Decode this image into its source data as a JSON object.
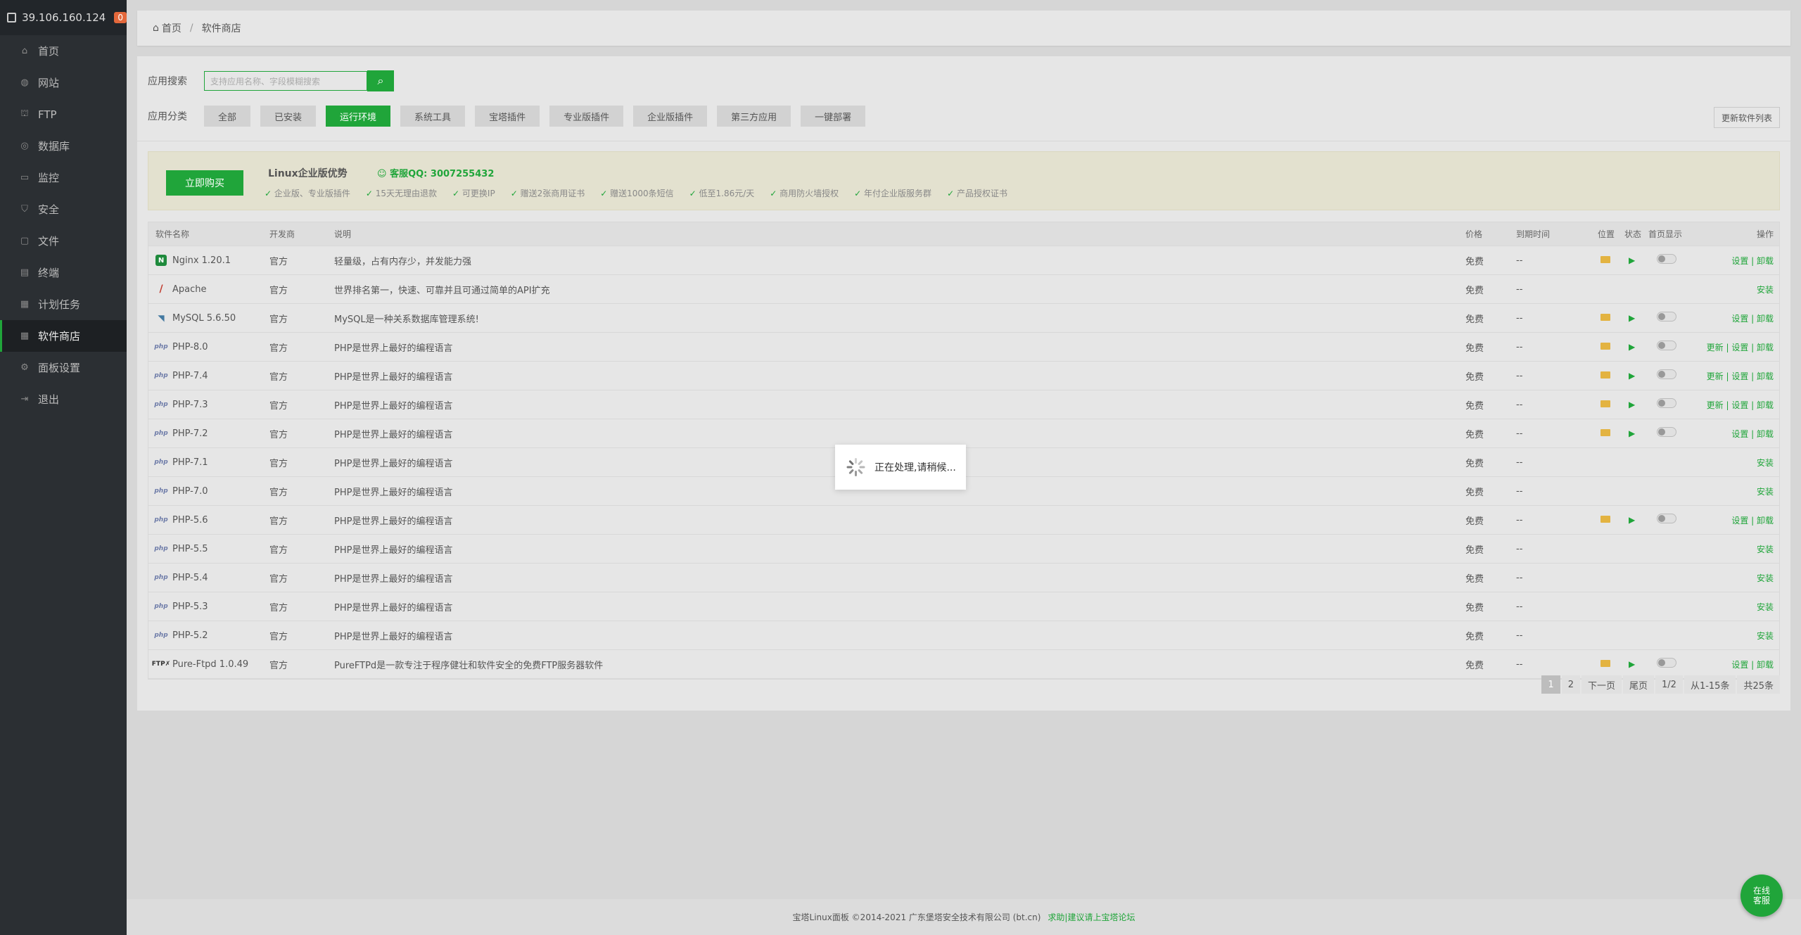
{
  "server": {
    "ip": "39.106.160.124",
    "badge": "0"
  },
  "nav": [
    {
      "label": "首页",
      "icon": "home-icon"
    },
    {
      "label": "网站",
      "icon": "globe-icon"
    },
    {
      "label": "FTP",
      "icon": "ftp-icon"
    },
    {
      "label": "数据库",
      "icon": "database-icon"
    },
    {
      "label": "监控",
      "icon": "monitor-icon"
    },
    {
      "label": "安全",
      "icon": "shield-icon"
    },
    {
      "label": "文件",
      "icon": "folder-icon"
    },
    {
      "label": "终端",
      "icon": "terminal-icon"
    },
    {
      "label": "计划任务",
      "icon": "calendar-icon"
    },
    {
      "label": "软件商店",
      "icon": "grid-icon",
      "active": true
    },
    {
      "label": "面板设置",
      "icon": "gear-icon"
    },
    {
      "label": "退出",
      "icon": "logout-icon"
    }
  ],
  "breadcrumb": {
    "home": "首页",
    "sep": "/",
    "current": "软件商店"
  },
  "search": {
    "label": "应用搜索",
    "placeholder": "支持应用名称、字段模糊搜索"
  },
  "categories": {
    "label": "应用分类",
    "items": [
      "全部",
      "已安装",
      "运行环境",
      "系统工具",
      "宝塔插件",
      "专业版插件",
      "企业版插件",
      "第三方应用",
      "一键部署"
    ],
    "active_index": 2
  },
  "refresh_label": "更新软件列表",
  "promo": {
    "buy": "立即购买",
    "title": "Linux企业版优势",
    "qq": "客服QQ: 3007255432",
    "features": [
      "企业版、专业版插件",
      "15天无理由退款",
      "可更换IP",
      "赠送2张商用证书",
      "赠送1000条短信",
      "低至1.86元/天",
      "商用防火墙授权",
      "年付企业版服务群",
      "产品授权证书"
    ]
  },
  "table": {
    "headers": {
      "name": "软件名称",
      "dev": "开发商",
      "desc": "说明",
      "price": "价格",
      "exp": "到期时间",
      "pos": "位置",
      "state": "状态",
      "home": "首页显示",
      "ops": "操作"
    },
    "rows": [
      {
        "logo": "N",
        "type": "nginx",
        "name": "Nginx 1.20.1",
        "dev": "官方",
        "desc": "轻量级，占有内存少，并发能力强",
        "price": "免费",
        "exp": "--",
        "installed": true,
        "ops": "设置 | 卸载"
      },
      {
        "logo": "/",
        "type": "apache",
        "name": "Apache",
        "dev": "官方",
        "desc": "世界排名第一，快速、可靠并且可通过简单的API扩充",
        "price": "免费",
        "exp": "--",
        "installed": false,
        "ops": "安装"
      },
      {
        "logo": "◥",
        "type": "mysql",
        "name": "MySQL 5.6.50",
        "dev": "官方",
        "desc": "MySQL是一种关系数据库管理系统!",
        "price": "免费",
        "exp": "--",
        "installed": true,
        "ops": "设置 | 卸载"
      },
      {
        "logo": "php",
        "type": "php",
        "name": "PHP-8.0",
        "dev": "官方",
        "desc": "PHP是世界上最好的编程语言",
        "price": "免费",
        "exp": "--",
        "installed": true,
        "ops": "更新 | 设置 | 卸载"
      },
      {
        "logo": "php",
        "type": "php",
        "name": "PHP-7.4",
        "dev": "官方",
        "desc": "PHP是世界上最好的编程语言",
        "price": "免费",
        "exp": "--",
        "installed": true,
        "ops": "更新 | 设置 | 卸载"
      },
      {
        "logo": "php",
        "type": "php",
        "name": "PHP-7.3",
        "dev": "官方",
        "desc": "PHP是世界上最好的编程语言",
        "price": "免费",
        "exp": "--",
        "installed": true,
        "ops": "更新 | 设置 | 卸载"
      },
      {
        "logo": "php",
        "type": "php",
        "name": "PHP-7.2",
        "dev": "官方",
        "desc": "PHP是世界上最好的编程语言",
        "price": "免费",
        "exp": "--",
        "installed": true,
        "ops": "设置 | 卸载"
      },
      {
        "logo": "php",
        "type": "php",
        "name": "PHP-7.1",
        "dev": "官方",
        "desc": "PHP是世界上最好的编程语言",
        "price": "免费",
        "exp": "--",
        "installed": false,
        "ops": "安装"
      },
      {
        "logo": "php",
        "type": "php",
        "name": "PHP-7.0",
        "dev": "官方",
        "desc": "PHP是世界上最好的编程语言",
        "price": "免费",
        "exp": "--",
        "installed": false,
        "ops": "安装"
      },
      {
        "logo": "php",
        "type": "php",
        "name": "PHP-5.6",
        "dev": "官方",
        "desc": "PHP是世界上最好的编程语言",
        "price": "免费",
        "exp": "--",
        "installed": true,
        "ops": "设置 | 卸载"
      },
      {
        "logo": "php",
        "type": "php",
        "name": "PHP-5.5",
        "dev": "官方",
        "desc": "PHP是世界上最好的编程语言",
        "price": "免费",
        "exp": "--",
        "installed": false,
        "ops": "安装"
      },
      {
        "logo": "php",
        "type": "php",
        "name": "PHP-5.4",
        "dev": "官方",
        "desc": "PHP是世界上最好的编程语言",
        "price": "免费",
        "exp": "--",
        "installed": false,
        "ops": "安装"
      },
      {
        "logo": "php",
        "type": "php",
        "name": "PHP-5.3",
        "dev": "官方",
        "desc": "PHP是世界上最好的编程语言",
        "price": "免费",
        "exp": "--",
        "installed": false,
        "ops": "安装"
      },
      {
        "logo": "php",
        "type": "php",
        "name": "PHP-5.2",
        "dev": "官方",
        "desc": "PHP是世界上最好的编程语言",
        "price": "免费",
        "exp": "--",
        "installed": false,
        "ops": "安装"
      },
      {
        "logo": "FTP✗",
        "type": "ftp",
        "name": "Pure-Ftpd 1.0.49",
        "dev": "官方",
        "desc": "PureFTPd是一款专注于程序健壮和软件安全的免费FTP服务器软件",
        "price": "免费",
        "exp": "--",
        "installed": true,
        "ops": "设置 | 卸载"
      }
    ]
  },
  "pager": [
    "1",
    "2",
    "下一页",
    "尾页",
    "1/2",
    "从1-15条",
    "共25条"
  ],
  "footer": {
    "copyright": "宝塔Linux面板 ©2014-2021 广东堡塔安全技术有限公司 (bt.cn)",
    "link": "求助|建议请上宝塔论坛"
  },
  "loading": "正在处理,请稍候...",
  "chat": "在线客服",
  "colors": {
    "accent": "#20a53a",
    "sidebar": "#2b2f33",
    "badge": "#e3683b"
  }
}
